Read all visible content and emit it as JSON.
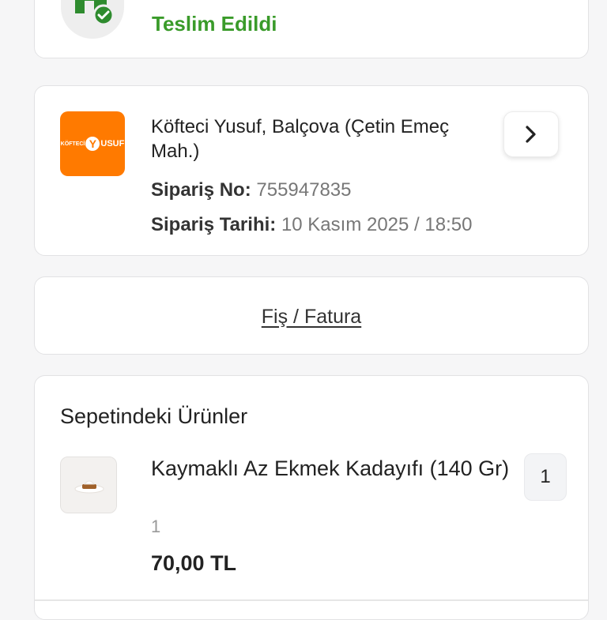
{
  "status": {
    "text": "Teslim Edildi",
    "icon": "house-check-icon",
    "color": "#3a9b2a"
  },
  "order": {
    "restaurant_name": "Köfteci Yusuf, Balçova (Çetin Emeç Mah.)",
    "logo": {
      "small": "KÖFTECİ",
      "letter": "Y",
      "rest": "USUF",
      "color": "#ff7a00"
    },
    "order_no_label": "Sipariş No:",
    "order_no": "755947835",
    "order_date_label": "Sipariş Tarihi:",
    "order_date": "10 Kasım 2025 / 18:50"
  },
  "receipt": {
    "link_label": "Fiş / Fatura"
  },
  "basket": {
    "title": "Sepetindeki Ürünler",
    "items": [
      {
        "name": "Kaymaklı Az Ekmek Kadayıfı (140 Gr)",
        "quantity_sub": "1",
        "price": "70,00 TL",
        "quantity": "1"
      }
    ]
  }
}
